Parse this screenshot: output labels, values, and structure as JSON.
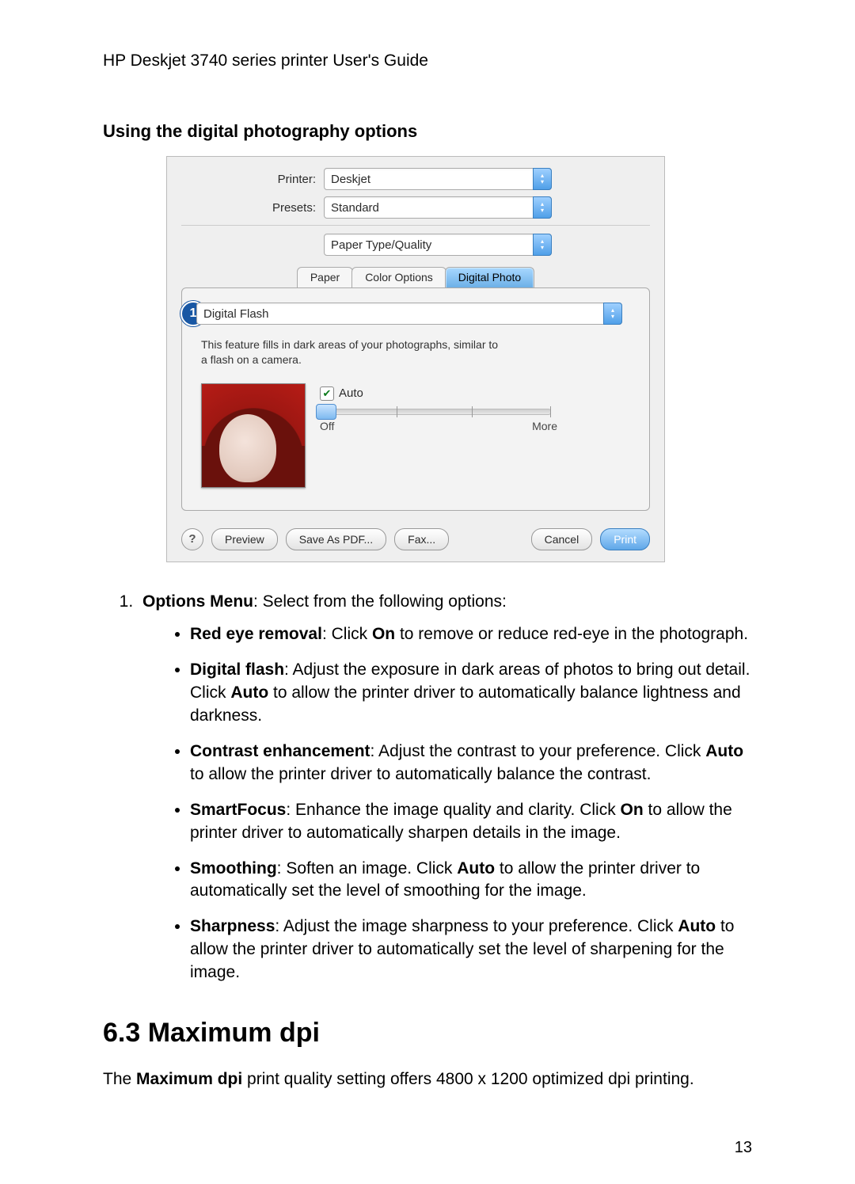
{
  "header": "HP Deskjet 3740 series printer User's Guide",
  "subheading": "Using the digital photography options",
  "dialog": {
    "printer_label": "Printer:",
    "printer_value": "Deskjet",
    "presets_label": "Presets:",
    "presets_value": "Standard",
    "panel_select": "Paper Type/Quality",
    "tabs": {
      "paper": "Paper",
      "color": "Color Options",
      "digital": "Digital Photo"
    },
    "badge": "1",
    "flash_option": "Digital Flash",
    "flash_desc": "This feature fills in dark areas of your photographs, similar to a flash on a camera.",
    "auto_label": "Auto",
    "slider_min": "Off",
    "slider_max": "More",
    "buttons": {
      "preview": "Preview",
      "save_pdf": "Save As PDF...",
      "fax": "Fax...",
      "cancel": "Cancel",
      "print": "Print"
    }
  },
  "list": {
    "intro_bold": "Options Menu",
    "intro_rest": ": Select from the following options:",
    "items": {
      "redeye": {
        "t1": "Red eye removal",
        "t2": ": Click ",
        "t3": "On",
        "t4": " to remove or reduce red-eye in the photograph."
      },
      "dflash": {
        "t1": "Digital flash",
        "t2": ": Adjust the exposure in dark areas of photos to bring out detail. Click ",
        "t3": "Auto",
        "t4": " to allow the printer driver to automatically balance lightness and darkness."
      },
      "contrast": {
        "t1": "Contrast enhancement",
        "t2": ": Adjust the contrast to your preference. Click ",
        "t3": "Auto",
        "t4": " to allow the printer driver to automatically balance the contrast."
      },
      "smartfocus": {
        "t1": "SmartFocus",
        "t2": ": Enhance the image quality and clarity. Click ",
        "t3": "On",
        "t4": " to allow the printer driver to automatically sharpen details in the image."
      },
      "smoothing": {
        "t1": "Smoothing",
        "t2": ": Soften an image. Click ",
        "t3": "Auto",
        "t4": " to allow the printer driver to automatically set the level of smoothing for the image."
      },
      "sharpness": {
        "t1": "Sharpness",
        "t2": ": Adjust the image sharpness to your preference. Click ",
        "t3": "Auto",
        "t4": " to allow the printer driver to automatically set the level of sharpening for the image."
      }
    }
  },
  "section63": {
    "heading": "6.3  Maximum dpi",
    "p1a": "The ",
    "p1b": "Maximum dpi",
    "p1c": " print quality setting offers 4800 x 1200 optimized dpi printing."
  },
  "page_number": "13"
}
